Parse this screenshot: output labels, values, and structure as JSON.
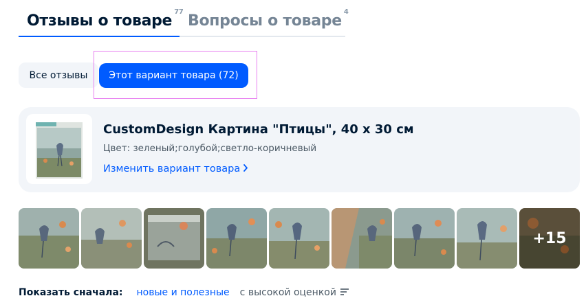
{
  "tabs": {
    "reviews": {
      "label": "Отзывы о товаре",
      "count": "77"
    },
    "questions": {
      "label": "Вопросы о товаре",
      "count": "4"
    }
  },
  "filters": {
    "all_label": "Все отзывы",
    "variant_label": "Этот вариант товара (72)"
  },
  "variant": {
    "title": "CustomDesign Картина \"Птицы\", 40 x 30 см",
    "color_label": "Цвет:",
    "color_value": "зеленый;голубой;светло-коричневый",
    "change_link": "Изменить вариант товара",
    "chevron_icon": "chevron-right-icon"
  },
  "gallery": {
    "more_label": "+15"
  },
  "sort": {
    "label": "Показать сначала:",
    "option_active": "новые и полезные",
    "option_2": "с высокой оценкой",
    "icon": "sort-lines-icon"
  },
  "colors": {
    "accent": "#005bff",
    "card_bg": "#f2f5f9",
    "text_primary": "#001a34",
    "text_muted": "#758595",
    "highlight_border": "#e77ff0"
  }
}
